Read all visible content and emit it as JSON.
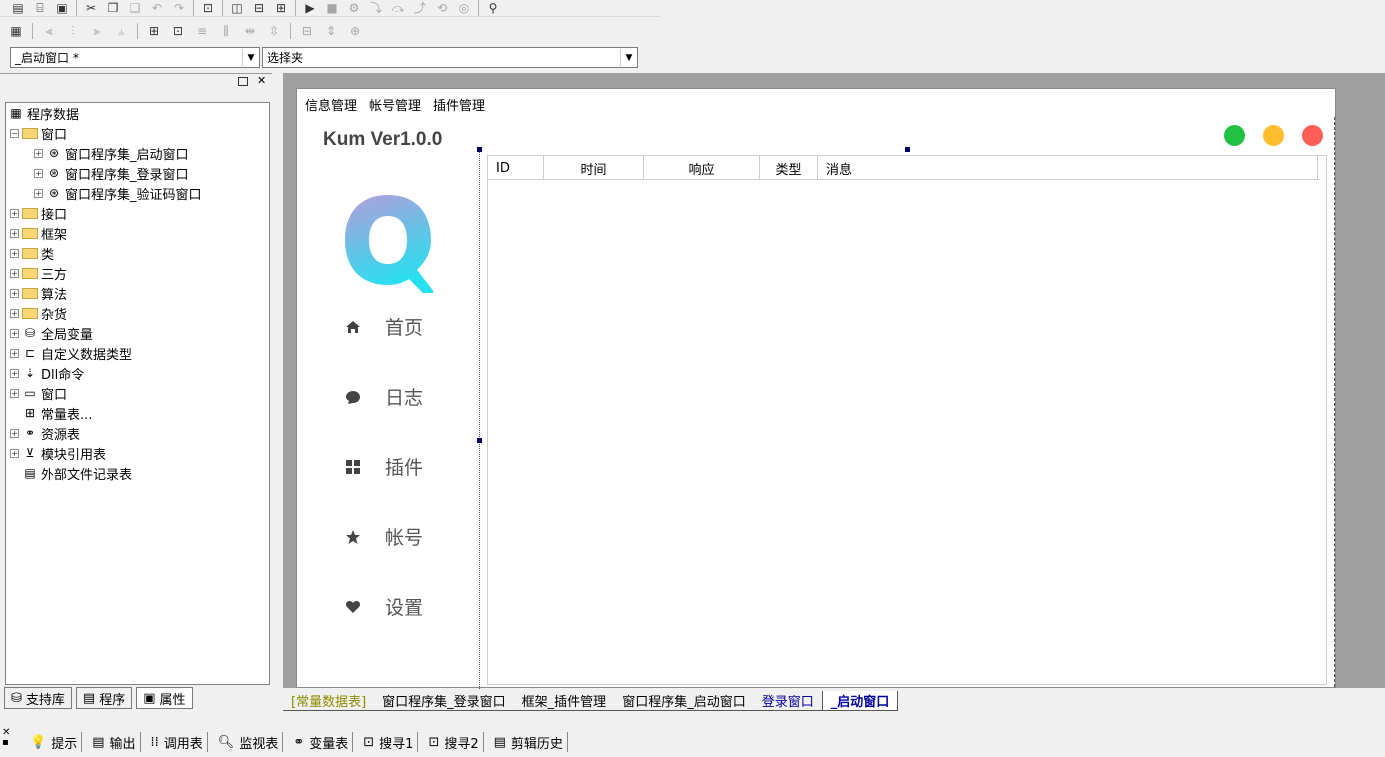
{
  "toolbar_row1": {
    "icons": [
      "new-file-icon",
      "open-folder-icon",
      "save-icon",
      "cut-icon",
      "copy-icon",
      "paste-icon",
      "undo-icon",
      "redo-icon",
      "find-icon",
      "layout-1-icon",
      "layout-2-icon",
      "layout-3-icon",
      "run-icon",
      "stop-icon",
      "step-icon",
      "step-into-icon",
      "step-over-icon",
      "step-out-icon",
      "breakpoint-icon",
      "target-icon",
      "binoculars-icon"
    ]
  },
  "toolbar_row2": {
    "icons": [
      "calc-icon",
      "align-left-icon",
      "align-center-icon",
      "align-right-icon",
      "align-top-icon",
      "grid-icon",
      "snap-icon",
      "arrange-icon",
      "distribute-icon",
      "size-h-icon",
      "size-v-icon",
      "center-icon"
    ]
  },
  "combo_window": {
    "value": "_启动窗口 *"
  },
  "combo_folder": {
    "value": "选择夹"
  },
  "tree": {
    "root": "程序数据",
    "items": [
      {
        "label": "窗口",
        "level": 1,
        "expanded": true,
        "icon": "folder"
      },
      {
        "label": "窗口程序集_启动窗口",
        "level": 2,
        "icon": "module"
      },
      {
        "label": "窗口程序集_登录窗口",
        "level": 2,
        "icon": "module"
      },
      {
        "label": "窗口程序集_验证码窗口",
        "level": 2,
        "icon": "module"
      },
      {
        "label": "接口",
        "level": 1,
        "icon": "folder"
      },
      {
        "label": "框架",
        "level": 1,
        "icon": "folder"
      },
      {
        "label": "类",
        "level": 1,
        "icon": "folder"
      },
      {
        "label": "三方",
        "level": 1,
        "icon": "folder"
      },
      {
        "label": "算法",
        "level": 1,
        "icon": "folder"
      },
      {
        "label": "杂货",
        "level": 1,
        "icon": "folder"
      },
      {
        "label": "全局变量",
        "level": 1,
        "icon": "db"
      },
      {
        "label": "自定义数据类型",
        "level": 1,
        "icon": "type"
      },
      {
        "label": "Dll命令",
        "level": 1,
        "icon": "dll"
      },
      {
        "label": "窗口",
        "level": 1,
        "icon": "window"
      },
      {
        "label": "常量表...",
        "level": 1,
        "icon": "const",
        "noexp": true
      },
      {
        "label": "资源表",
        "level": 1,
        "icon": "res"
      },
      {
        "label": "模块引用表",
        "level": 1,
        "icon": "mod"
      },
      {
        "label": "外部文件记录表",
        "level": 1,
        "icon": "file",
        "noexp": true
      }
    ]
  },
  "left_tabs": [
    "支持库",
    "程序",
    "属性"
  ],
  "form": {
    "menu": [
      "信息管理",
      "帐号管理",
      "插件管理"
    ],
    "version": "Kum Ver1.0.0",
    "nav": [
      {
        "label": "首页",
        "icon": "home-icon"
      },
      {
        "label": "日志",
        "icon": "chat-icon"
      },
      {
        "label": "插件",
        "icon": "plugin-icon"
      },
      {
        "label": "帐号",
        "icon": "star-icon"
      },
      {
        "label": "设置",
        "icon": "heart-icon"
      }
    ],
    "lights": [
      "#21c142",
      "#ffbd2e",
      "#ff5f57"
    ],
    "columns": [
      "ID",
      "时间",
      "响应",
      "类型",
      "消息"
    ]
  },
  "doc_tabs": [
    "[常量数据表]",
    "窗口程序集_登录窗口",
    "框架_插件管理",
    "窗口程序集_启动窗口",
    "登录窗口",
    "_启动窗口"
  ],
  "bottom_tools": [
    "提示",
    "输出",
    "调用表",
    "监视表",
    "变量表",
    "搜寻1",
    "搜寻2",
    "剪辑历史"
  ],
  "colors": {
    "accent_top": "#b39ddb",
    "accent_bottom": "#26e0f0",
    "blue_link": "#0000a0",
    "tab_olive": "#8b8b00"
  }
}
